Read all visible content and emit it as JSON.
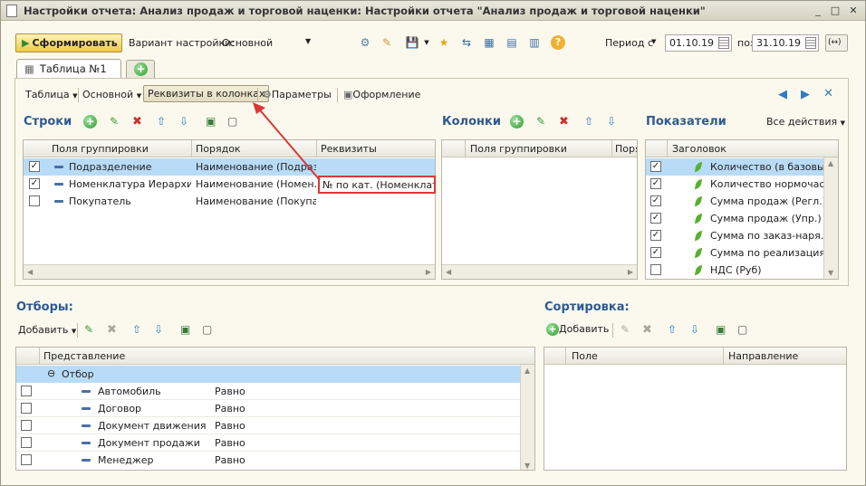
{
  "window": {
    "title": "Настройки отчета: Анализ продаж и торговой наценки: Настройки отчета \"Анализ продаж и торговой наценки\"",
    "min": "_",
    "max": "□",
    "close": "✕"
  },
  "toolbar": {
    "generate_label": "Сформировать",
    "variant_label": "Вариант настройки:",
    "variant_value": "Основной",
    "period_label": "Период с",
    "date_from": "01.10.19",
    "to_label": "по:",
    "date_to": "31.10.19",
    "period_btn": "(↔)"
  },
  "tabs": {
    "active": "Таблица №1"
  },
  "subtoolbar": {
    "table": "Таблица",
    "main": "Основной",
    "requisites_cols": "Реквизиты в колонках",
    "params": "Параметры",
    "design": "Оформление"
  },
  "rows_section": {
    "title": "Строки",
    "columns": [
      "Поля группировки",
      "Порядок",
      "Реквизиты"
    ],
    "rows": [
      {
        "checked": true,
        "field": "Подразделение",
        "order": "Наименование (Подраз…",
        "req": ""
      },
      {
        "checked": true,
        "field": "Номенклатура Иерархия",
        "order": "Наименование (Номен…",
        "req": "№ по кат. (Номенклату…"
      },
      {
        "checked": false,
        "field": "Покупатель",
        "order": "Наименование (Покупа…",
        "req": ""
      }
    ]
  },
  "columns_section": {
    "title": "Колонки",
    "columns": [
      "Поля группировки",
      "Поря"
    ]
  },
  "indicators_section": {
    "title": "Показатели",
    "all_actions": "Все действия",
    "column": "Заголовок",
    "rows": [
      {
        "checked": true,
        "label": "Количество (в базовы…"
      },
      {
        "checked": true,
        "label": "Количество нормочас…"
      },
      {
        "checked": true,
        "label": "Сумма продаж (Регл.)…"
      },
      {
        "checked": true,
        "label": "Сумма продаж (Упр.) (…"
      },
      {
        "checked": true,
        "label": "Сумма по заказ-наря…"
      },
      {
        "checked": true,
        "label": "Сумма по реализация…"
      },
      {
        "checked": false,
        "label": "НДС (Руб)"
      }
    ]
  },
  "filters_section": {
    "title": "Отборы:",
    "add_label": "Добавить",
    "column": "Представление",
    "group": "Отбор",
    "rows": [
      {
        "field": "Автомобиль",
        "cond": "Равно"
      },
      {
        "field": "Договор",
        "cond": "Равно"
      },
      {
        "field": "Документ движения",
        "cond": "Равно"
      },
      {
        "field": "Документ продажи",
        "cond": "Равно"
      },
      {
        "field": "Менеджер",
        "cond": "Равно"
      }
    ]
  },
  "sort_section": {
    "title": "Сортировка:",
    "add_label": "Добавить",
    "columns": [
      "Поле",
      "Направление"
    ]
  },
  "colors": {
    "accent": "#2e5a93",
    "selection": "#b8dcf8",
    "highlight": "#d93838"
  }
}
